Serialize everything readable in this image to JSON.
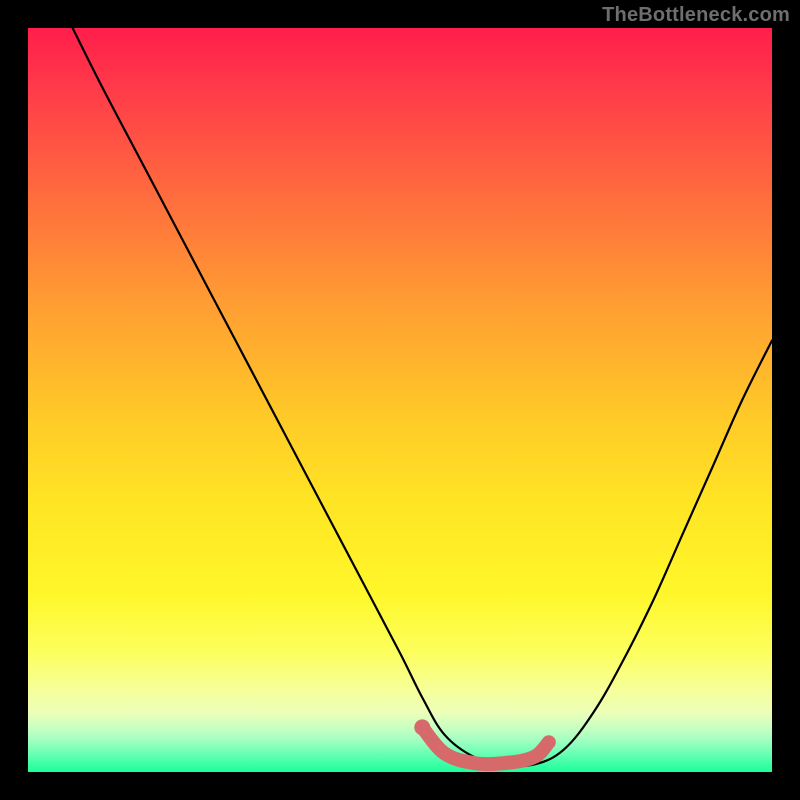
{
  "watermark": "TheBottleneck.com",
  "chart_data": {
    "type": "line",
    "title": "",
    "xlabel": "",
    "ylabel": "",
    "xlim": [
      0,
      100
    ],
    "ylim": [
      0,
      100
    ],
    "grid": false,
    "legend": false,
    "series": [
      {
        "name": "bottleneck-curve",
        "color": "#000000",
        "x": [
          6,
          10,
          15,
          20,
          25,
          30,
          35,
          40,
          45,
          50,
          53,
          56,
          60,
          64,
          68,
          72,
          76,
          80,
          84,
          88,
          92,
          96,
          100
        ],
        "values": [
          100,
          92,
          82.5,
          73,
          63.5,
          54,
          44.5,
          35,
          25.5,
          16,
          10,
          5,
          2,
          1,
          1,
          3,
          8,
          15,
          23,
          32,
          41,
          50,
          58
        ]
      },
      {
        "name": "optimal-highlight",
        "color": "#d66a6a",
        "x": [
          53,
          56,
          60,
          64,
          68,
          70
        ],
        "values": [
          6,
          2.5,
          1.2,
          1.2,
          2,
          4
        ]
      }
    ],
    "annotations": []
  }
}
